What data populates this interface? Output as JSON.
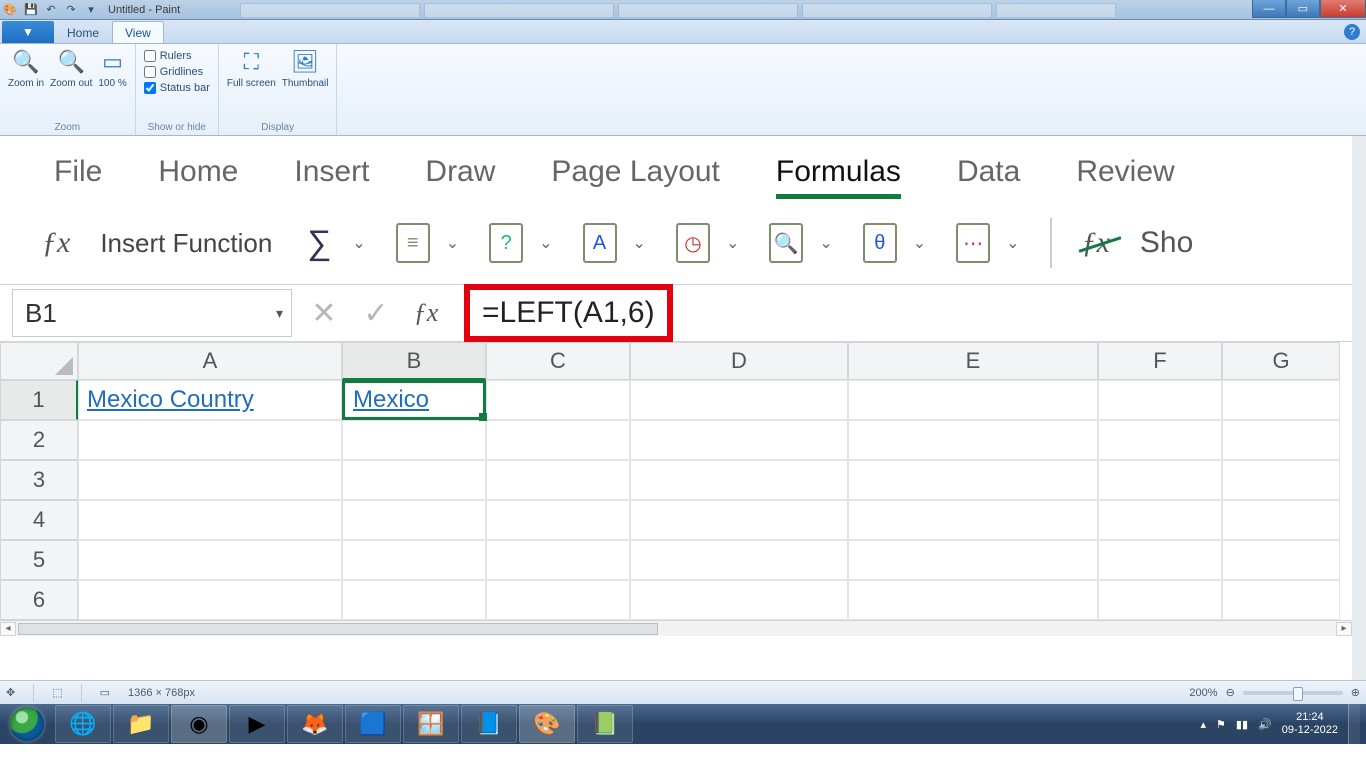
{
  "window": {
    "title": "Untitled - Paint"
  },
  "paint": {
    "tabs": {
      "file": "",
      "home": "Home",
      "view": "View"
    },
    "zoom": {
      "in": "Zoom in",
      "out": "Zoom out",
      "hundred": "100 %",
      "group": "Zoom"
    },
    "show": {
      "rulers": "Rulers",
      "gridlines": "Gridlines",
      "statusbar": "Status bar",
      "group": "Show or hide",
      "statusbar_checked": true
    },
    "display": {
      "full": "Full screen",
      "thumb": "Thumbnail",
      "group": "Display"
    }
  },
  "excel": {
    "tabs": {
      "file": "File",
      "home": "Home",
      "insert": "Insert",
      "draw": "Draw",
      "layout": "Page Layout",
      "formulas": "Formulas",
      "data": "Data",
      "review": "Review"
    },
    "toolbar": {
      "insert_fn": "Insert Function",
      "show": "Sho"
    },
    "namebox": "B1",
    "formula": "=LEFT(A1,6)",
    "columns": [
      "A",
      "B",
      "C",
      "D",
      "E",
      "F",
      "G"
    ],
    "rows": [
      "1",
      "2",
      "3",
      "4",
      "5",
      "6"
    ],
    "cells": {
      "A1": "Mexico Country",
      "B1": "Mexico"
    }
  },
  "statusbar": {
    "cursor": "",
    "dims": "1366 × 768px",
    "zoom": "200%"
  },
  "tray": {
    "time": "21:24",
    "date": "09-12-2022"
  }
}
